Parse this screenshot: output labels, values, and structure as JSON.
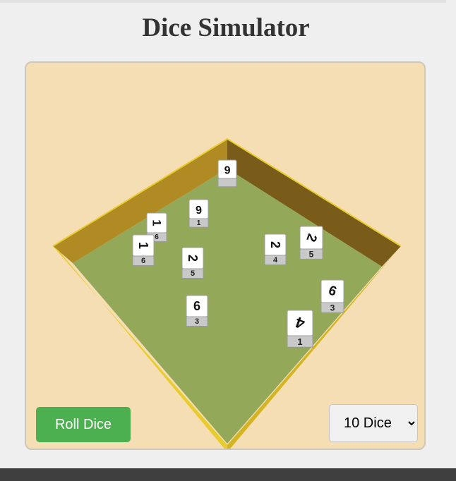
{
  "page": {
    "title": "Dice Simulator"
  },
  "controls": {
    "roll_label": "Roll Dice",
    "dice_count_selected": "10 Dice",
    "dice_count_options": [
      "10 Dice"
    ]
  },
  "colors": {
    "background": "#efefef",
    "stage_background": "#f5deb3",
    "floor": "#94a85a",
    "wall_left": "#b08a22",
    "wall_right": "#7a5c1a",
    "rim": "#e8cb2c",
    "button": "#4caf50"
  },
  "dice": [
    {
      "front": "6",
      "side": ""
    },
    {
      "front": "6",
      "side": "1"
    },
    {
      "front": "1",
      "side": "6"
    },
    {
      "front": "1",
      "side": "6"
    },
    {
      "front": "2",
      "side": "5"
    },
    {
      "front": "2",
      "side": "4"
    },
    {
      "front": "2",
      "side": "5"
    },
    {
      "front": "6",
      "side": "3"
    },
    {
      "front": "6",
      "side": "3"
    },
    {
      "front": "4",
      "side": "1"
    }
  ]
}
